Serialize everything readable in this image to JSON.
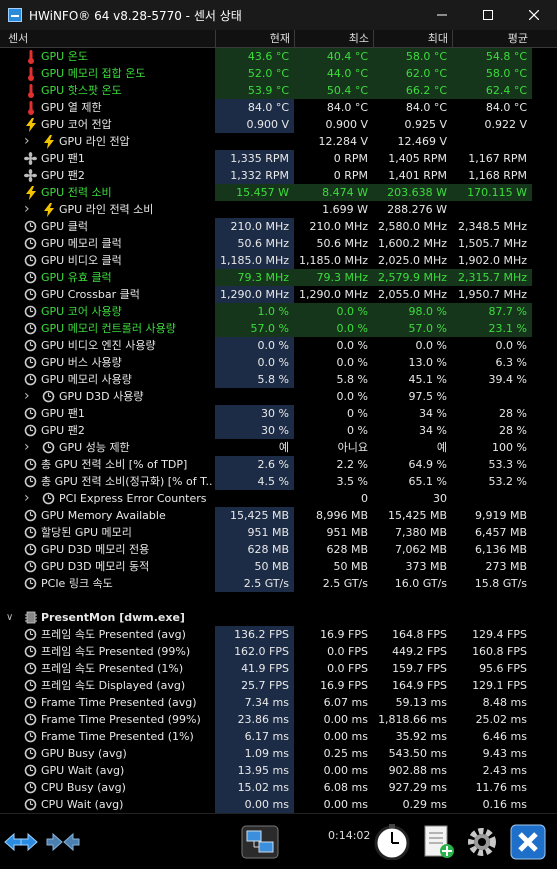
{
  "window": {
    "title": "HWiNFO® 64 v8.28-5770 - 센서 상태"
  },
  "header": {
    "sensor": "센서",
    "current": "현재",
    "min": "최소",
    "max": "최대",
    "avg": "평균"
  },
  "rows": [
    {
      "label": "GPU 온도",
      "icon": "thermometer-icon",
      "indent": 1,
      "green": true,
      "v": [
        "43.6 °C",
        "40.4 °C",
        "58.0 °C",
        "54.8 °C"
      ]
    },
    {
      "label": "GPU 메모리 접합 온도",
      "icon": "thermometer-icon",
      "indent": 1,
      "green": true,
      "v": [
        "52.0 °C",
        "44.0 °C",
        "62.0 °C",
        "58.0 °C"
      ]
    },
    {
      "label": "GPU 핫스팟 온도",
      "icon": "thermometer-icon",
      "indent": 1,
      "green": true,
      "v": [
        "53.9 °C",
        "50.4 °C",
        "66.2 °C",
        "62.4 °C"
      ]
    },
    {
      "label": "GPU 열 제한",
      "icon": "thermometer-icon",
      "indent": 1,
      "v": [
        "84.0 °C",
        "84.0 °C",
        "84.0 °C",
        "84.0 °C"
      ]
    },
    {
      "label": "GPU 코어 전압",
      "icon": "lightning-icon",
      "indent": 1,
      "v": [
        "0.900 V",
        "0.900 V",
        "0.925 V",
        "0.922 V"
      ]
    },
    {
      "label": "GPU 라인 전압",
      "icon": "lightning-icon",
      "indent": 2,
      "expand": true,
      "v": [
        "",
        "12.284 V",
        "12.469 V",
        ""
      ]
    },
    {
      "label": "GPU 팬1",
      "icon": "fan-icon",
      "indent": 1,
      "v": [
        "1,335 RPM",
        "0 RPM",
        "1,405 RPM",
        "1,167 RPM"
      ]
    },
    {
      "label": "GPU 팬2",
      "icon": "fan-icon",
      "indent": 1,
      "v": [
        "1,332 RPM",
        "0 RPM",
        "1,401 RPM",
        "1,168 RPM"
      ]
    },
    {
      "label": "GPU 전력 소비",
      "icon": "lightning-icon",
      "indent": 1,
      "green": true,
      "v": [
        "15.457 W",
        "8.474 W",
        "203.638 W",
        "170.115 W"
      ]
    },
    {
      "label": "GPU 라인 전력 소비",
      "icon": "lightning-icon",
      "indent": 2,
      "expand": true,
      "v": [
        "",
        "1.699 W",
        "288.276 W",
        ""
      ]
    },
    {
      "label": "GPU 클럭",
      "icon": "clock-icon",
      "indent": 1,
      "v": [
        "210.0 MHz",
        "210.0 MHz",
        "2,580.0 MHz",
        "2,348.5 MHz"
      ]
    },
    {
      "label": "GPU 메모리 클럭",
      "icon": "clock-icon",
      "indent": 1,
      "v": [
        "50.6 MHz",
        "50.6 MHz",
        "1,600.2 MHz",
        "1,505.7 MHz"
      ]
    },
    {
      "label": "GPU 비디오 클럭",
      "icon": "clock-icon",
      "indent": 1,
      "v": [
        "1,185.0 MHz",
        "1,185.0 MHz",
        "2,025.0 MHz",
        "1,902.0 MHz"
      ]
    },
    {
      "label": "GPU 유효 클럭",
      "icon": "clock-icon",
      "indent": 1,
      "green": true,
      "v": [
        "79.3 MHz",
        "79.3 MHz",
        "2,579.9 MHz",
        "2,315.7 MHz"
      ]
    },
    {
      "label": "GPU Crossbar 클럭",
      "icon": "clock-icon",
      "indent": 1,
      "v": [
        "1,290.0 MHz",
        "1,290.0 MHz",
        "2,055.0 MHz",
        "1,950.7 MHz"
      ]
    },
    {
      "label": "GPU 코어 사용량",
      "icon": "clock-icon",
      "indent": 1,
      "green": true,
      "v": [
        "1.0 %",
        "0.0 %",
        "98.0 %",
        "87.7 %"
      ]
    },
    {
      "label": "GPU 메모리 컨트롤러 사용량",
      "icon": "clock-icon",
      "indent": 1,
      "green": true,
      "v": [
        "57.0 %",
        "0.0 %",
        "57.0 %",
        "23.1 %"
      ]
    },
    {
      "label": "GPU 비디오 엔진 사용량",
      "icon": "clock-icon",
      "indent": 1,
      "v": [
        "0.0 %",
        "0.0 %",
        "0.0 %",
        "0.0 %"
      ]
    },
    {
      "label": "GPU 버스 사용량",
      "icon": "clock-icon",
      "indent": 1,
      "v": [
        "0.0 %",
        "0.0 %",
        "13.0 %",
        "6.3 %"
      ]
    },
    {
      "label": "GPU 메모리 사용량",
      "icon": "clock-icon",
      "indent": 1,
      "v": [
        "5.8 %",
        "5.8 %",
        "45.1 %",
        "39.4 %"
      ]
    },
    {
      "label": "GPU D3D 사용량",
      "icon": "clock-icon",
      "indent": 2,
      "expand": true,
      "v": [
        "",
        "0.0 %",
        "97.5 %",
        ""
      ]
    },
    {
      "label": "GPU 팬1",
      "icon": "clock-icon",
      "indent": 1,
      "v": [
        "30 %",
        "0 %",
        "34 %",
        "28 %"
      ]
    },
    {
      "label": "GPU 팬2",
      "icon": "clock-icon",
      "indent": 1,
      "v": [
        "30 %",
        "0 %",
        "34 %",
        "28 %"
      ]
    },
    {
      "label": "GPU 성능 제한",
      "icon": "clock-icon",
      "indent": 2,
      "expand": true,
      "v": [
        "예",
        "아니요",
        "예",
        "100 %"
      ]
    },
    {
      "label": "총 GPU 전력 소비 [% of TDP]",
      "icon": "clock-icon",
      "indent": 1,
      "v": [
        "2.6 %",
        "2.2 %",
        "64.9 %",
        "53.3 %"
      ]
    },
    {
      "label": "총 GPU 전력 소비(정규화) [% of T...",
      "icon": "clock-icon",
      "indent": 1,
      "v": [
        "4.5 %",
        "3.5 %",
        "65.1 %",
        "53.2 %"
      ]
    },
    {
      "label": "PCI Express Error Counters",
      "icon": "clock-icon",
      "indent": 2,
      "expand": true,
      "v": [
        "",
        "0",
        "30",
        ""
      ]
    },
    {
      "label": "GPU Memory Available",
      "icon": "clock-icon",
      "indent": 1,
      "v": [
        "15,425 MB",
        "8,996 MB",
        "15,425 MB",
        "9,919 MB"
      ]
    },
    {
      "label": "할당된 GPU 메모리",
      "icon": "clock-icon",
      "indent": 1,
      "v": [
        "951 MB",
        "951 MB",
        "7,380 MB",
        "6,457 MB"
      ]
    },
    {
      "label": "GPU D3D 메모리 전용",
      "icon": "clock-icon",
      "indent": 1,
      "v": [
        "628 MB",
        "628 MB",
        "7,062 MB",
        "6,136 MB"
      ]
    },
    {
      "label": "GPU D3D 메모리 동적",
      "icon": "clock-icon",
      "indent": 1,
      "v": [
        "50 MB",
        "50 MB",
        "373 MB",
        "273 MB"
      ]
    },
    {
      "label": "PCIe 링크 속도",
      "icon": "clock-icon",
      "indent": 1,
      "v": [
        "2.5 GT/s",
        "2.5 GT/s",
        "16.0 GT/s",
        "15.8 GT/s"
      ]
    },
    {
      "blank": true
    },
    {
      "label": "PresentMon [dwm.exe]",
      "icon": "chip-icon",
      "group": true
    },
    {
      "label": "프레임 속도 Presented (avg)",
      "icon": "clock-icon",
      "indent": 1,
      "v": [
        "136.2 FPS",
        "16.9 FPS",
        "164.8 FPS",
        "129.4 FPS"
      ]
    },
    {
      "label": "프레임 속도 Presented (99%)",
      "icon": "clock-icon",
      "indent": 1,
      "v": [
        "162.0 FPS",
        "0.0 FPS",
        "449.2 FPS",
        "160.8 FPS"
      ]
    },
    {
      "label": "프레임 속도 Presented (1%)",
      "icon": "clock-icon",
      "indent": 1,
      "v": [
        "41.9 FPS",
        "0.0 FPS",
        "159.7 FPS",
        "95.6 FPS"
      ]
    },
    {
      "label": "프레임 속도 Displayed (avg)",
      "icon": "clock-icon",
      "indent": 1,
      "v": [
        "25.7 FPS",
        "16.9 FPS",
        "164.9 FPS",
        "129.1 FPS"
      ]
    },
    {
      "label": "Frame Time Presented (avg)",
      "icon": "clock-icon",
      "indent": 1,
      "v": [
        "7.34 ms",
        "6.07 ms",
        "59.13 ms",
        "8.48 ms"
      ]
    },
    {
      "label": "Frame Time Presented (99%)",
      "icon": "clock-icon",
      "indent": 1,
      "v": [
        "23.86 ms",
        "0.00 ms",
        "1,818.66 ms",
        "25.02 ms"
      ]
    },
    {
      "label": "Frame Time Presented (1%)",
      "icon": "clock-icon",
      "indent": 1,
      "v": [
        "6.17 ms",
        "0.00 ms",
        "35.92 ms",
        "6.46 ms"
      ]
    },
    {
      "label": "GPU Busy (avg)",
      "icon": "clock-icon",
      "indent": 1,
      "v": [
        "1.09 ms",
        "0.25 ms",
        "543.50 ms",
        "9.43 ms"
      ]
    },
    {
      "label": "GPU Wait (avg)",
      "icon": "clock-icon",
      "indent": 1,
      "v": [
        "13.95 ms",
        "0.00 ms",
        "902.88 ms",
        "2.43 ms"
      ]
    },
    {
      "label": "CPU Busy (avg)",
      "icon": "clock-icon",
      "indent": 1,
      "v": [
        "15.02 ms",
        "6.08 ms",
        "927.29 ms",
        "11.76 ms"
      ]
    },
    {
      "label": "CPU Wait (avg)",
      "icon": "clock-icon",
      "indent": 1,
      "v": [
        "0.00 ms",
        "0.00 ms",
        "0.29 ms",
        "0.16 ms"
      ]
    }
  ],
  "toolbar": {
    "elapsed": "0:14:02"
  }
}
